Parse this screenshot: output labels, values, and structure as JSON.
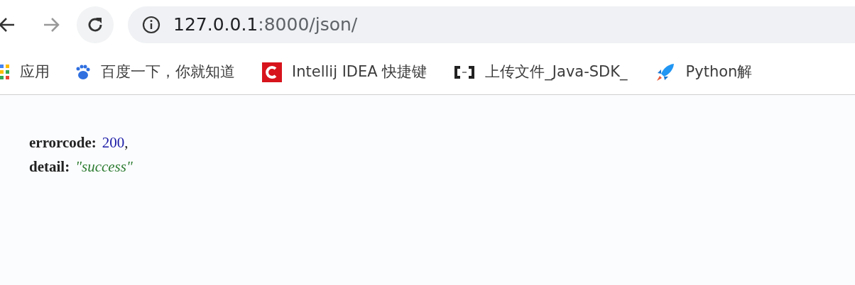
{
  "address_bar": {
    "host": "127.0.0.1",
    "path": ":8000/json/"
  },
  "bookmarks": [
    {
      "kind": "apps",
      "label": "应用"
    },
    {
      "kind": "paw",
      "label": "百度一下，你就知道"
    },
    {
      "kind": "red",
      "label": "Intellij IDEA 快捷键"
    },
    {
      "kind": "brackets",
      "label": "上传文件_Java-SDK_"
    },
    {
      "kind": "rocket",
      "label": "Python解"
    }
  ],
  "json_lines": [
    {
      "key": "errorcode:",
      "value": "200",
      "kind": "number",
      "separator": ","
    },
    {
      "key": "detail:",
      "value": "\"success\"",
      "kind": "string"
    }
  ]
}
